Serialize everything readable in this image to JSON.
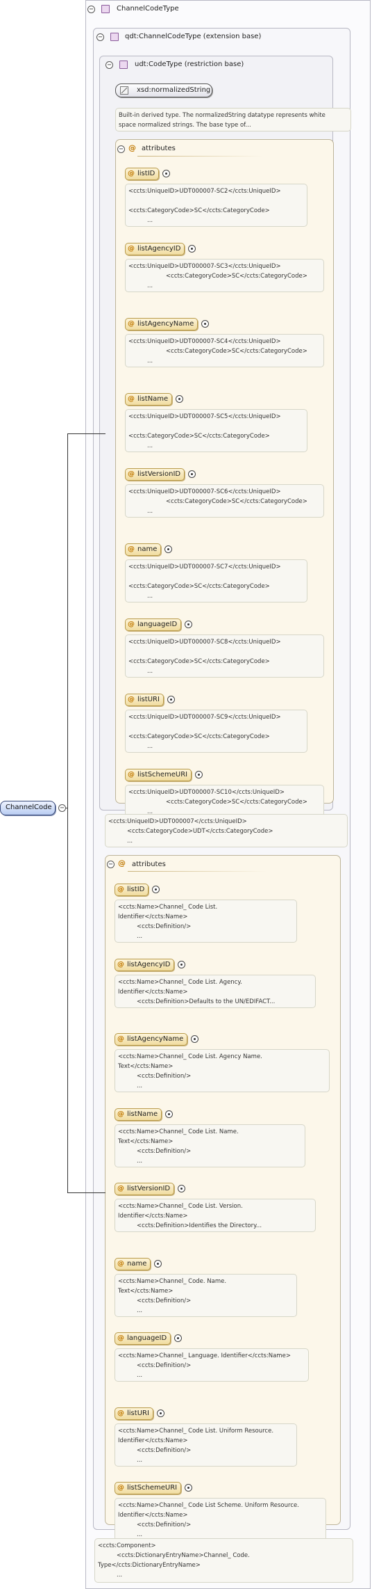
{
  "root": {
    "title": "ChannelCodeType",
    "element_name": "ChannelCode"
  },
  "qdt": {
    "title": "qdt:ChannelCodeType (extension base)"
  },
  "udt": {
    "title": "udt:CodeType (restriction base)",
    "xsd_type": "xsd:normalizedString",
    "xsd_doc": "Built-in derived type. The normalizedString datatype represents white\nspace normalized strings. The base type of...",
    "attributes_label": "attributes",
    "attributes": [
      {
        "name": "listID",
        "doc": "<ccts:UniqueID>UDT000007-SC2</ccts:UniqueID>\n\n<ccts:CategoryCode>SC</ccts:CategoryCode>\n          ..."
      },
      {
        "name": "listAgencyID",
        "doc": "<ccts:UniqueID>UDT000007-SC3</ccts:UniqueID>\n                    <ccts:CategoryCode>SC</ccts:CategoryCode>\n          ..."
      },
      {
        "name": "listAgencyName",
        "doc": "<ccts:UniqueID>UDT000007-SC4</ccts:UniqueID>\n                    <ccts:CategoryCode>SC</ccts:CategoryCode>\n          ..."
      },
      {
        "name": "listName",
        "doc": "<ccts:UniqueID>UDT000007-SC5</ccts:UniqueID>\n\n<ccts:CategoryCode>SC</ccts:CategoryCode>\n          ..."
      },
      {
        "name": "listVersionID",
        "doc": "<ccts:UniqueID>UDT000007-SC6</ccts:UniqueID>\n                    <ccts:CategoryCode>SC</ccts:CategoryCode>\n          ..."
      },
      {
        "name": "name",
        "doc": "<ccts:UniqueID>UDT000007-SC7</ccts:UniqueID>\n\n<ccts:CategoryCode>SC</ccts:CategoryCode>\n          ..."
      },
      {
        "name": "languageID",
        "doc": "<ccts:UniqueID>UDT000007-SC8</ccts:UniqueID>\n\n<ccts:CategoryCode>SC</ccts:CategoryCode>\n          ..."
      },
      {
        "name": "listURI",
        "doc": "<ccts:UniqueID>UDT000007-SC9</ccts:UniqueID>\n\n<ccts:CategoryCode>SC</ccts:CategoryCode>\n          ..."
      },
      {
        "name": "listSchemeURI",
        "doc": "<ccts:UniqueID>UDT000007-SC10</ccts:UniqueID>\n                    <ccts:CategoryCode>SC</ccts:CategoryCode>\n          ..."
      }
    ],
    "doc": "<ccts:UniqueID>UDT000007</ccts:UniqueID>\n          <ccts:CategoryCode>UDT</ccts:CategoryCode>\n          ..."
  },
  "qdt_attributes": {
    "label": "attributes",
    "items": [
      {
        "name": "listID",
        "doc": "<ccts:Name>Channel_ Code List.\nIdentifier</ccts:Name>\n          <ccts:Definition/>\n          ..."
      },
      {
        "name": "listAgencyID",
        "doc": "<ccts:Name>Channel_ Code List. Agency.\nIdentifier</ccts:Name>\n          <ccts:Definition>Defaults to the UN/EDIFACT..."
      },
      {
        "name": "listAgencyName",
        "doc": "<ccts:Name>Channel_ Code List. Agency Name.\nText</ccts:Name>\n          <ccts:Definition/>\n          ..."
      },
      {
        "name": "listName",
        "doc": "<ccts:Name>Channel_ Code List. Name.\nText</ccts:Name>\n          <ccts:Definition/>\n          ..."
      },
      {
        "name": "listVersionID",
        "doc": "<ccts:Name>Channel_ Code List. Version.\nIdentifier</ccts:Name>\n          <ccts:Definition>Identifies the Directory..."
      },
      {
        "name": "name",
        "doc": "<ccts:Name>Channel_ Code. Name.\nText</ccts:Name>\n          <ccts:Definition/>\n          ..."
      },
      {
        "name": "languageID",
        "doc": "<ccts:Name>Channel_ Language. Identifier</ccts:Name>\n          <ccts:Definition/>\n          ..."
      },
      {
        "name": "listURI",
        "doc": "<ccts:Name>Channel_ Code List. Uniform Resource.\nIdentifier</ccts:Name>\n          <ccts:Definition/>\n          ..."
      },
      {
        "name": "listSchemeURI",
        "doc": "<ccts:Name>Channel_ Code List Scheme. Uniform Resource.\nIdentifier</ccts:Name>\n          <ccts:Definition/>\n          ..."
      }
    ]
  },
  "root_doc": "<ccts:Component>\n          <ccts:DictionaryEntryName>Channel_ Code.\nType</ccts:DictionaryEntryName>\n          ..."
}
